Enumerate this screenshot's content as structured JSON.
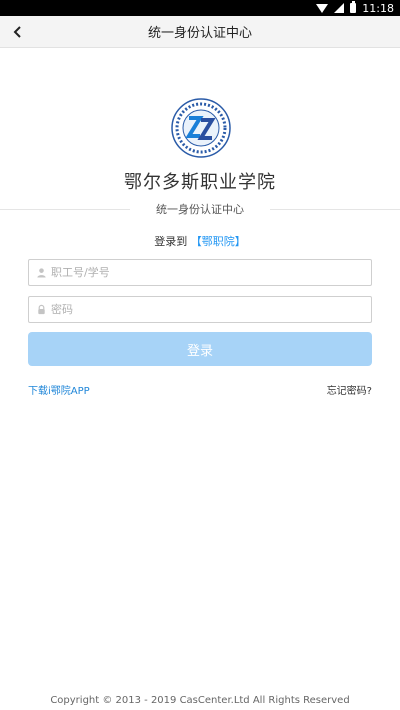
{
  "status_bar": {
    "time": "11:18"
  },
  "nav": {
    "title": "统一身份认证中心"
  },
  "logo": {
    "name": "ZZ school emblem"
  },
  "school": {
    "name": "鄂尔多斯职业学院"
  },
  "divider": {
    "text": "统一身份认证中心"
  },
  "login_to": {
    "prefix": "登录到",
    "target": "【鄂职院】"
  },
  "form": {
    "username_placeholder": "职工号/学号",
    "username_value": "",
    "password_placeholder": "密码",
    "password_value": "",
    "submit_label": "登录"
  },
  "links": {
    "download": "下载i鄂院APP",
    "forgot": "忘记密码?"
  },
  "footer": {
    "copyright": "Copyright © 2013 - 2019 CasCenter.Ltd All Rights Reserved"
  },
  "colors": {
    "accent": "#2196f3",
    "button_disabled": "#a7d3f7"
  },
  "icons": [
    "back-arrow-icon",
    "wifi-icon",
    "signal-icon",
    "battery-icon",
    "user-icon",
    "lock-icon"
  ]
}
